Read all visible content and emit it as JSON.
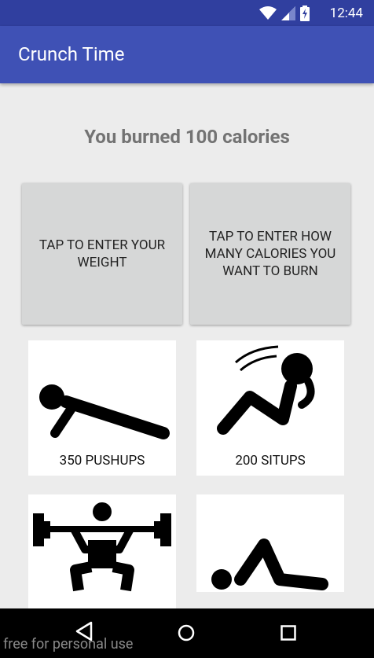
{
  "status_bar": {
    "time": "12:44",
    "icons": [
      "wifi-icon",
      "cell-signal-icon",
      "battery-icon"
    ]
  },
  "app_bar": {
    "title": "Crunch Time"
  },
  "summary": {
    "text": "You burned 100 calories"
  },
  "buttons": {
    "weight": "TAP TO ENTER YOUR WEIGHT",
    "calories": "TAP TO ENTER HOW MANY CALORIES YOU WANT TO BURN"
  },
  "exercises": [
    {
      "label": "350 PUSHUPS",
      "icon": "pushup-icon"
    },
    {
      "label": "200 SITUPS",
      "icon": "situp-icon"
    },
    {
      "label": "",
      "icon": "squat-icon"
    },
    {
      "label": "",
      "icon": "leg-lift-icon"
    }
  ],
  "watermark": "free for personal use",
  "colors": {
    "status_bar": "#303f9f",
    "app_bar": "#3f51b5",
    "background": "#ececec"
  }
}
